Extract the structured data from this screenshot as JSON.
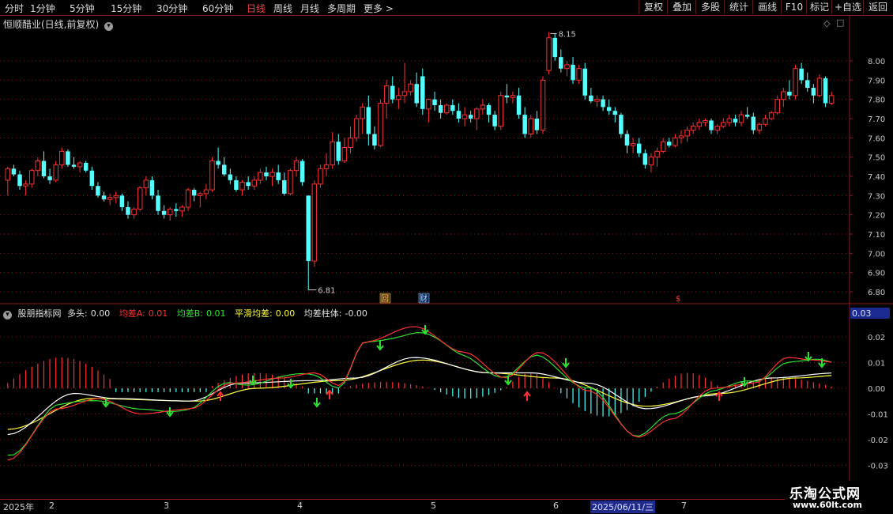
{
  "toolbar": {
    "periods": [
      "分时",
      "1分钟",
      "5分钟",
      "15分钟",
      "30分钟",
      "60分钟",
      "日线",
      "周线",
      "月线",
      "多周期",
      "更多 >"
    ],
    "active_index": 6,
    "right_buttons": [
      "复权",
      "叠加",
      "多股",
      "统计",
      "画线",
      "F10",
      "标记",
      "+自选",
      "返回"
    ]
  },
  "main_panel": {
    "title": "恒顺醋业(日线,前复权)",
    "price_axis": [
      "8.00",
      "7.90",
      "7.80",
      "7.70",
      "7.60",
      "7.50",
      "7.40",
      "7.30",
      "7.20",
      "7.10",
      "7.00",
      "6.90",
      "6.80"
    ],
    "high_label": "8.15",
    "low_label": "6.81",
    "event_markers": [
      "回",
      "财",
      "$"
    ]
  },
  "indicator_panel": {
    "name": "股朋指标网",
    "items": [
      {
        "label": "多头:",
        "value": "0.00",
        "color": "#e0e0e0"
      },
      {
        "label": "均差A:",
        "value": "0.01",
        "color": "#ff3030"
      },
      {
        "label": "均差B:",
        "value": "0.01",
        "color": "#30e030"
      },
      {
        "label": "平滑均差:",
        "value": "0.00",
        "color": "#ffff40"
      },
      {
        "label": "均差柱体:",
        "value": "-0.00",
        "color": "#e0e0e0"
      }
    ],
    "axis": [
      "0.02",
      "0.01",
      "0.00",
      "-0.01",
      "-0.02",
      "-0.03"
    ],
    "current_value": "0.03"
  },
  "date_axis": {
    "labels": [
      "2025年",
      "2",
      "3",
      "4",
      "5",
      "6",
      "7"
    ],
    "selected_date": "2025/06/11/三"
  },
  "watermark": {
    "line1": "乐淘公式网",
    "line2": "www.60lt.com"
  },
  "colors": {
    "up": "#ff3030",
    "down": "#54ffff",
    "grid": "#8b1a1a",
    "macd_white": "#ffffff",
    "macd_yellow": "#ffff40"
  }
}
